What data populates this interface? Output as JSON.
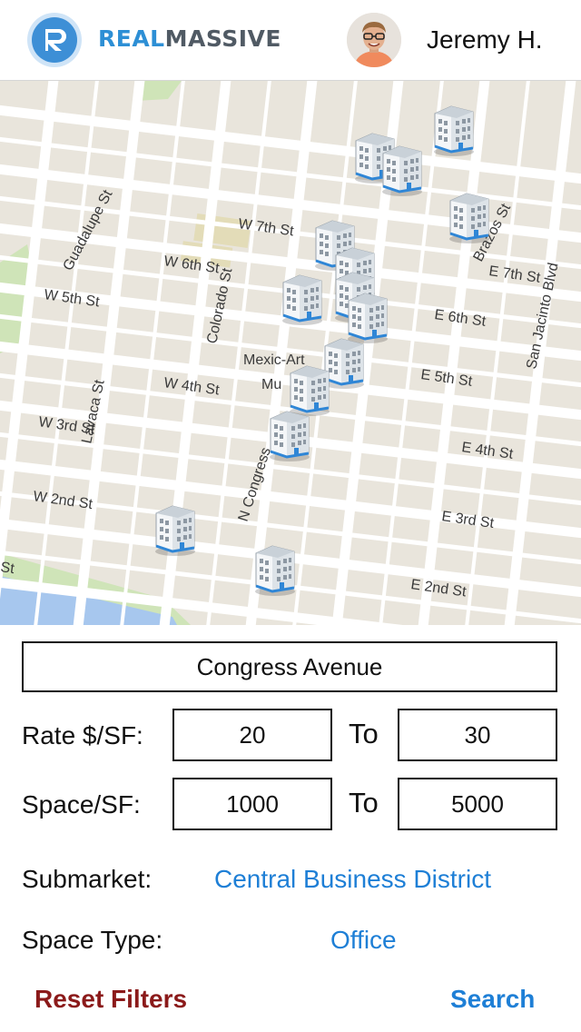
{
  "header": {
    "brand_part1": "REAL",
    "brand_part2": "MASSIVE",
    "user_name": "Jeremy H."
  },
  "map": {
    "street_labels": [
      "W 7th St",
      "W 6th St",
      "W 5th St",
      "W 4th St",
      "W 3rd St",
      "W 2nd St",
      "E 7th St",
      "E 6th St",
      "E 5th St",
      "E 4th St",
      "E 3rd St",
      "E 2nd St",
      "Guadalupe St",
      "Lavaca St",
      "Colorado St",
      "N Congress",
      "Brazos St",
      "San Jacinto Blvd",
      "St"
    ],
    "poi_label_1": "Mexic-Art",
    "poi_label_2": "Mu",
    "marker_icon": "building-icon",
    "colors": {
      "land": "#e9e5dc",
      "road": "#ffffff",
      "park": "#cfe4b8",
      "water": "#a7c7ee",
      "marker": "#2f86d6"
    }
  },
  "search": {
    "value": "Congress Avenue"
  },
  "rate": {
    "label": "Rate $/SF:",
    "min": "20",
    "to": "To",
    "max": "30"
  },
  "space": {
    "label": "Space/SF:",
    "min": "1000",
    "to": "To",
    "max": "5000"
  },
  "submarket": {
    "label": "Submarket:",
    "value": "Central Business District"
  },
  "space_type": {
    "label": "Space Type:",
    "value": "Office"
  },
  "actions": {
    "reset": "Reset Filters",
    "search": "Search"
  },
  "colors": {
    "accent": "#1e7fd6",
    "reset": "#8b1a1a"
  }
}
